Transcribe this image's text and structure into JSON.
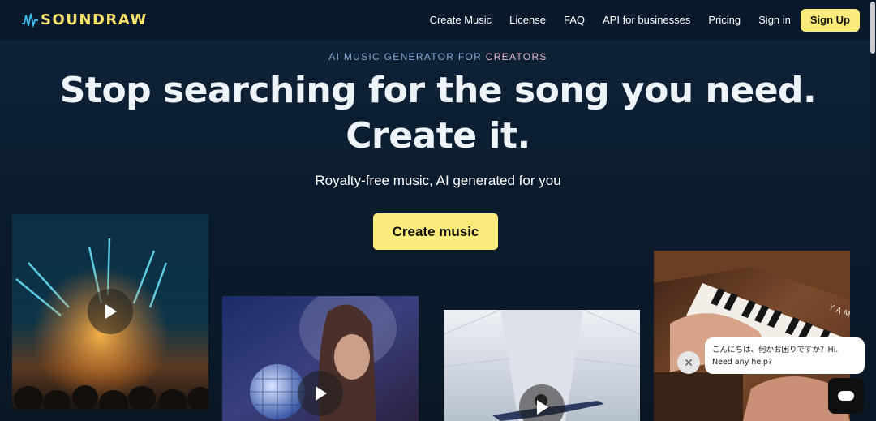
{
  "header": {
    "logo_text": "SOUNDRAW",
    "nav": [
      "Create Music",
      "License",
      "FAQ",
      "API for businesses",
      "Pricing",
      "Sign in"
    ],
    "signup_label": "Sign Up"
  },
  "hero": {
    "eyebrow_main": "AI MUSIC GENERATOR FOR ",
    "eyebrow_accent": "CREATORS",
    "headline_line1": "Stop searching for the song you need.",
    "headline_line2": "Create it.",
    "subhead": "Royalty-free music, AI generated for you",
    "cta_label": "Create music"
  },
  "media": {
    "piano_text": "Y A M"
  },
  "chat": {
    "message_line1": "こんにちは、何かお困りですか？Hi.",
    "message_line2": "Need any help?"
  },
  "colors": {
    "accent_yellow": "#fbea7c",
    "logo_yellow": "#f7e36a",
    "background": "#0b1a2b"
  },
  "icons": [
    "logo-wave-icon",
    "play-icon",
    "close-icon",
    "chat-icon"
  ]
}
